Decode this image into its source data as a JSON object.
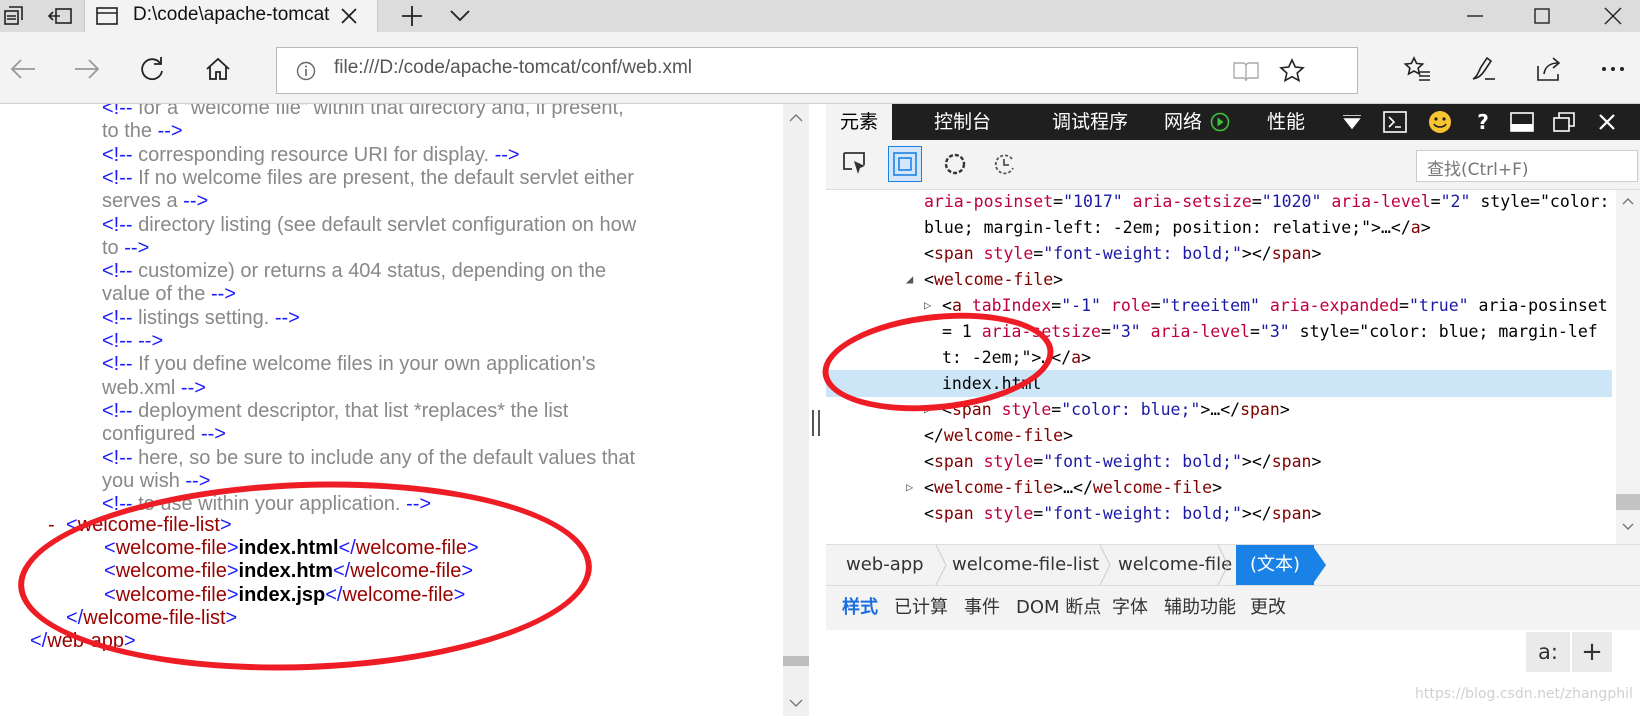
{
  "browser": {
    "tab_title": "D:\\code\\apache-tomcat",
    "address_url": "file:///D:/code/apache-tomcat/conf/web.xml",
    "icons": [
      "tab-actions-icon",
      "set-tabs-aside-icon",
      "close-icon",
      "new-tab-icon",
      "tab-preview-icon",
      "minimize-icon",
      "maximize-icon",
      "window-close-icon",
      "back-icon",
      "forward-icon",
      "refresh-icon",
      "home-icon",
      "info-icon",
      "reading-view-icon",
      "favorite-star-icon",
      "favorites-hub-icon",
      "web-note-icon",
      "share-icon",
      "more-icon"
    ]
  },
  "xml_view": {
    "comment_lines": [
      "<!-- for a \"welcome file\" within that directory and, if present,",
      "to the -->",
      "<!-- corresponding resource URI for display. -->",
      "<!-- If no welcome files are present, the default servlet either",
      "serves a -->",
      "<!-- directory listing (see default servlet configuration on how",
      "to -->",
      "<!-- customize) or returns a 404 status, depending on the",
      "value of the -->",
      "<!-- listings setting. -->",
      "<!-- -->",
      "<!-- If you define welcome files in your own application's",
      "web.xml -->",
      "<!-- deployment descriptor, that list *replaces* the list",
      "configured -->",
      "<!-- here, so be sure to include any of the default values that",
      "you wish -->",
      "<!-- to use within your application. -->"
    ],
    "collapse_marker": "-",
    "list_open": "<welcome-file-list>",
    "file_open": "<welcome-file>",
    "file_close": "</welcome-file>",
    "files": [
      "index.html",
      "index.htm",
      "index.jsp"
    ],
    "list_close": "</welcome-file-list>",
    "root_close": "</web-app>"
  },
  "devtools": {
    "tabs": [
      "元素",
      "控制台",
      "调试程序",
      "网络",
      "性能"
    ],
    "search_placeholder": "查找(Ctrl+F)",
    "dom_lines": [
      "aria-posinset=\"1017\" aria-setsize=\"1020\" aria-level=\"2\" style=\"color:",
      "blue; margin-left: -2em; position: relative;\">…</a>",
      "<span style=\"font-weight: bold;\"></span>",
      "<welcome-file>",
      "<a tabIndex=\"-1\" role=\"treeitem\" aria-expanded=\"true\" aria-posinset",
      "= 1  aria-setsize=\"3\" aria-level=\"3\" style=\"color: blue; margin-lef",
      "t: -2em;\">…</a>",
      "index.html",
      "<span style=\"color: blue;\">…</span>",
      "</welcome-file>",
      "<span style=\"font-weight: bold;\"></span>",
      "<welcome-file>…</welcome-file>",
      "<span style=\"font-weight: bold;\"></span>"
    ],
    "breadcrumbs": [
      "web-app",
      "welcome-file-list",
      "welcome-file",
      "(文本)"
    ],
    "sub_tabs": [
      "样式",
      "已计算",
      "事件",
      "DOM 断点",
      "字体",
      "辅助功能",
      "更改"
    ],
    "styles_buttons": [
      "a:",
      "+"
    ]
  },
  "watermark": "https://blog.csdn.net/zhangphil",
  "colors": {
    "annotation_red": "#ee1c24",
    "selected_row": "#cde6f7",
    "breadcrumb_active": "#1a82e6"
  }
}
